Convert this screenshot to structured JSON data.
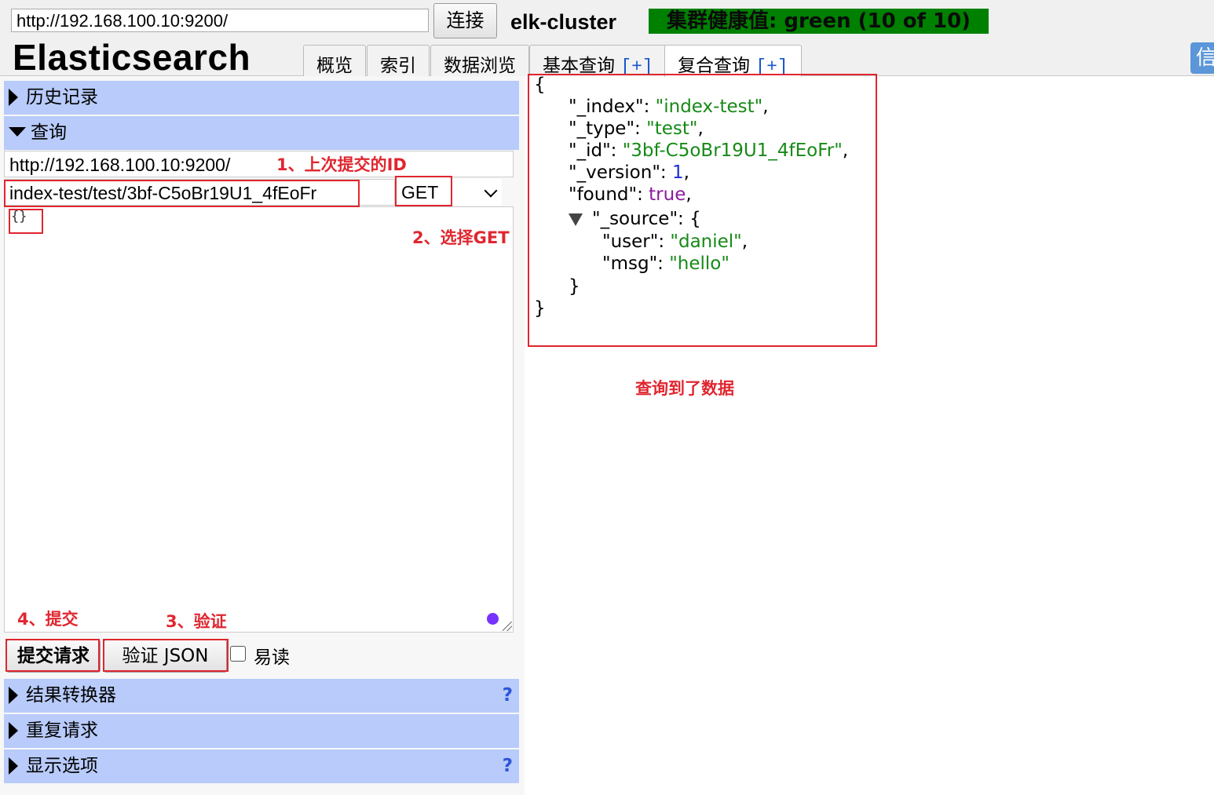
{
  "header": {
    "url": "http://192.168.100.10:9200/",
    "connect_label": "连接",
    "cluster_name": "elk-cluster",
    "health": "集群健康值: green (10 of 10)",
    "logo": "Elasticsearch",
    "info_label": "信",
    "tabs": [
      {
        "label": "概览"
      },
      {
        "label": "索引"
      },
      {
        "label": "数据浏览"
      },
      {
        "label": "基本查询",
        "plus": "[+]"
      },
      {
        "label": "复合查询",
        "plus": "[+]"
      }
    ]
  },
  "left": {
    "sections": {
      "history": "历史记录",
      "query": "查询",
      "transformer": "结果转换器",
      "repeat": "重复请求",
      "display": "显示选项"
    },
    "help": "?",
    "host": "http://192.168.100.10:9200/",
    "path": "index-test/test/3bf-C5oBr19U1_4fEoFr",
    "method": "GET",
    "body": "{}",
    "submit_label": "提交请求",
    "validate_label": "验证 JSON",
    "pretty_label": "易读"
  },
  "annotations": {
    "a1": "1、上次提交的ID",
    "a2": "2、选择GET",
    "a3": "3、验证",
    "a4": "4、提交",
    "result": "查询到了数据"
  },
  "result": {
    "index_key": "\"_index\"",
    "index_val": "\"index-test\"",
    "type_key": "\"_type\"",
    "type_val": "\"test\"",
    "id_key": "\"_id\"",
    "id_val": "\"3bf-C5oBr19U1_4fEoFr\"",
    "version_key": "\"_version\"",
    "version_val": "1",
    "found_key": "\"found\"",
    "found_val": "true",
    "source_key": "\"_source\"",
    "user_key": "\"user\"",
    "user_val": "\"daniel\"",
    "msg_key": "\"msg\"",
    "msg_val": "\"hello\""
  },
  "colors": {
    "health_bg": "#008000",
    "section_bg": "#b8cbfa",
    "annotation": "#e0262f",
    "json_string": "#168a16",
    "json_number": "#1a2fd6",
    "json_bool": "#8b1a9c"
  }
}
